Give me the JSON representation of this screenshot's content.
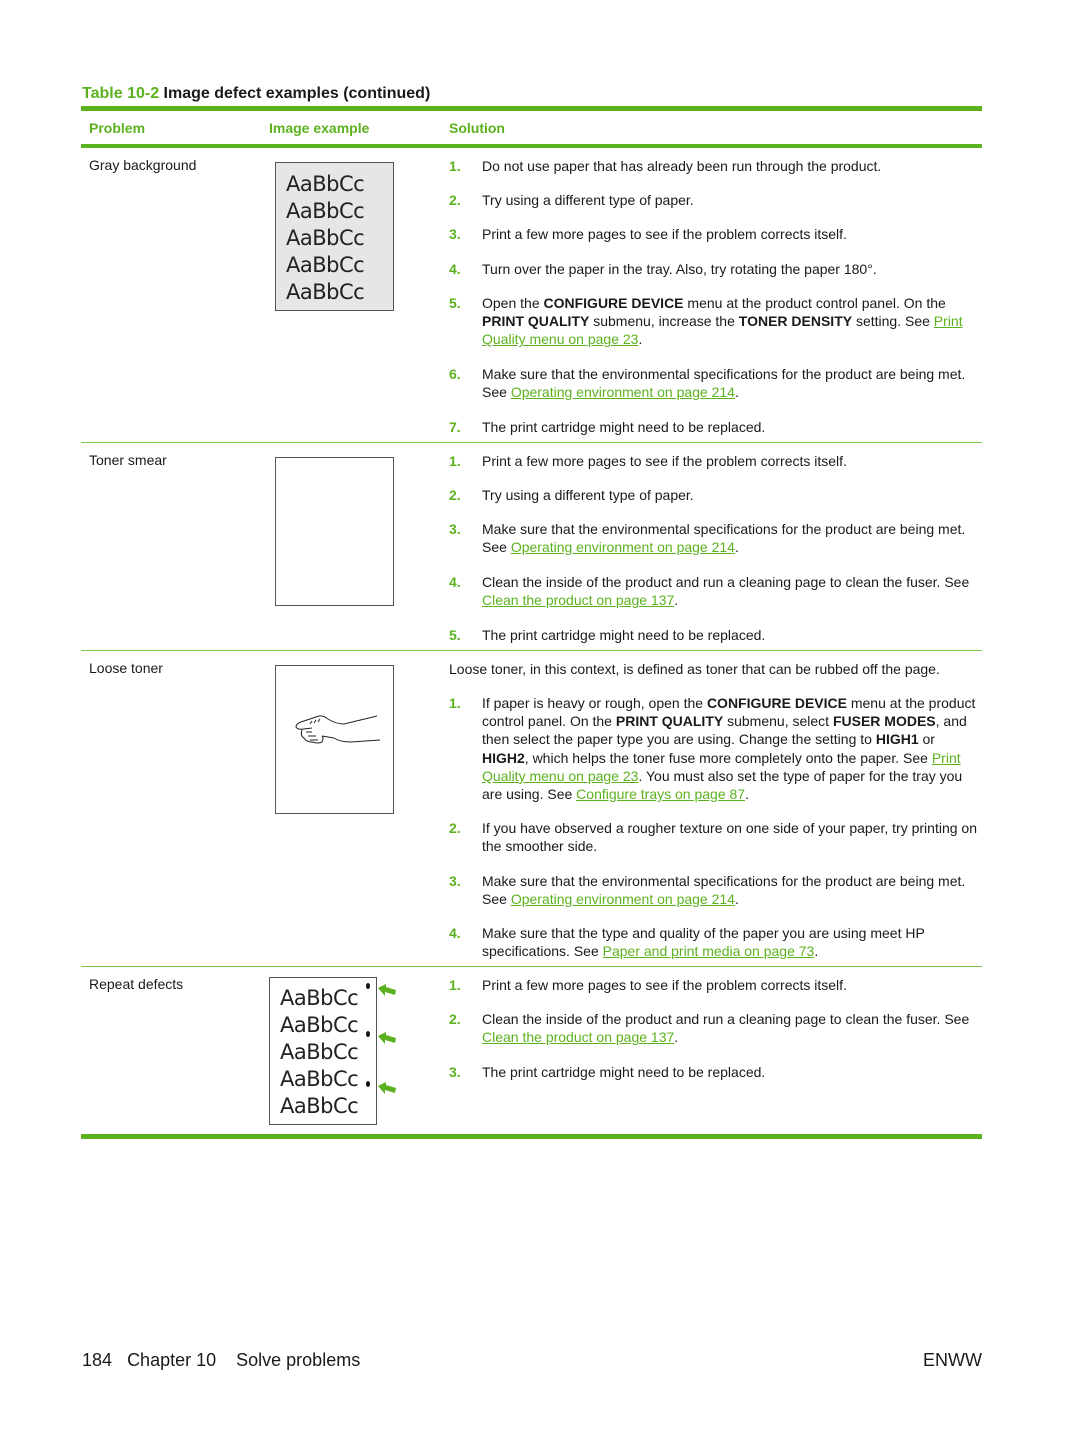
{
  "table": {
    "label": "Table",
    "number": "10-2",
    "title": "Image defect examples (continued)",
    "headers": {
      "problem": "Problem",
      "image": "Image example",
      "solution": "Solution"
    }
  },
  "sample_text": "AaBbCc",
  "rows": [
    {
      "problem": "Gray background",
      "image_icon": "gray-background-sample",
      "steps": [
        {
          "num": "1.",
          "parts": [
            {
              "t": "Do not use paper that has already been run through the product."
            }
          ]
        },
        {
          "num": "2.",
          "parts": [
            {
              "t": "Try using a different type of paper."
            }
          ]
        },
        {
          "num": "3.",
          "parts": [
            {
              "t": "Print a few more pages to see if the problem corrects itself."
            }
          ]
        },
        {
          "num": "4.",
          "parts": [
            {
              "t": "Turn over the paper in the tray. Also, try rotating the paper 180°."
            }
          ]
        },
        {
          "num": "5.",
          "parts": [
            {
              "t": "Open the "
            },
            {
              "b": "CONFIGURE DEVICE"
            },
            {
              "t": " menu at the product control panel. On the "
            },
            {
              "b": "PRINT QUALITY"
            },
            {
              "t": " submenu, increase the "
            },
            {
              "b": "TONER DENSITY"
            },
            {
              "t": " setting. See "
            },
            {
              "a": "Print Quality menu on page 23"
            },
            {
              "t": "."
            }
          ]
        },
        {
          "num": "6.",
          "parts": [
            {
              "t": "Make sure that the environmental specifications for the product are being met. See "
            },
            {
              "a": "Operating environment on page 214"
            },
            {
              "t": "."
            }
          ]
        },
        {
          "num": "7.",
          "parts": [
            {
              "t": "The print cartridge might need to be replaced."
            }
          ]
        }
      ]
    },
    {
      "problem": "Toner smear",
      "image_icon": "toner-smear-sample",
      "steps": [
        {
          "num": "1.",
          "parts": [
            {
              "t": "Print a few more pages to see if the problem corrects itself."
            }
          ]
        },
        {
          "num": "2.",
          "parts": [
            {
              "t": "Try using a different type of paper."
            }
          ]
        },
        {
          "num": "3.",
          "parts": [
            {
              "t": "Make sure that the environmental specifications for the product are being met. See "
            },
            {
              "a": "Operating environment on page 214"
            },
            {
              "t": "."
            }
          ]
        },
        {
          "num": "4.",
          "parts": [
            {
              "t": "Clean the inside of the product and run a cleaning page to clean the fuser. See "
            },
            {
              "a": "Clean the product on page 137"
            },
            {
              "t": "."
            }
          ]
        },
        {
          "num": "5.",
          "parts": [
            {
              "t": "The print cartridge might need to be replaced."
            }
          ]
        }
      ]
    },
    {
      "problem": "Loose toner",
      "image_icon": "hand-rubbing-page-sample",
      "intro": "Loose toner, in this context, is defined as toner that can be rubbed off the page.",
      "steps": [
        {
          "num": "1.",
          "parts": [
            {
              "t": "If paper is heavy or rough, open the "
            },
            {
              "b": "CONFIGURE DEVICE"
            },
            {
              "t": " menu at the product control panel. On the "
            },
            {
              "b": "PRINT QUALITY"
            },
            {
              "t": " submenu, select "
            },
            {
              "b": "FUSER MODES"
            },
            {
              "t": ", and then select the paper type you are using. Change the setting to "
            },
            {
              "b": "HIGH1"
            },
            {
              "t": " or "
            },
            {
              "b": "HIGH2"
            },
            {
              "t": ", which helps the toner fuse more completely onto the paper. See "
            },
            {
              "a": "Print Quality menu on page 23"
            },
            {
              "t": ". You must also set the type of paper for the tray you are using. See "
            },
            {
              "a": "Configure trays on page 87"
            },
            {
              "t": "."
            }
          ]
        },
        {
          "num": "2.",
          "parts": [
            {
              "t": "If you have observed a rougher texture on one side of your paper, try printing on the smoother side."
            }
          ]
        },
        {
          "num": "3.",
          "parts": [
            {
              "t": "Make sure that the environmental specifications for the product are being met. See "
            },
            {
              "a": "Operating environment on page 214"
            },
            {
              "t": "."
            }
          ]
        },
        {
          "num": "4.",
          "parts": [
            {
              "t": "Make sure that the type and quality of the paper you are using meet HP specifications. See "
            },
            {
              "a": "Paper and print media on page 73"
            },
            {
              "t": "."
            }
          ]
        }
      ]
    },
    {
      "problem": "Repeat defects",
      "image_icon": "repeat-defects-sample",
      "steps": [
        {
          "num": "1.",
          "parts": [
            {
              "t": "Print a few more pages to see if the problem corrects itself."
            }
          ]
        },
        {
          "num": "2.",
          "parts": [
            {
              "t": "Clean the inside of the product and run a cleaning page to clean the fuser. See "
            },
            {
              "a": "Clean the product on page 137"
            },
            {
              "t": "."
            }
          ]
        },
        {
          "num": "3.",
          "parts": [
            {
              "t": "The print cartridge might need to be replaced."
            }
          ]
        }
      ]
    }
  ],
  "footer": {
    "page_number": "184",
    "chapter": "Chapter 10",
    "section": "Solve problems",
    "locale": "ENWW"
  },
  "colors": {
    "accent": "#5cb21e"
  }
}
